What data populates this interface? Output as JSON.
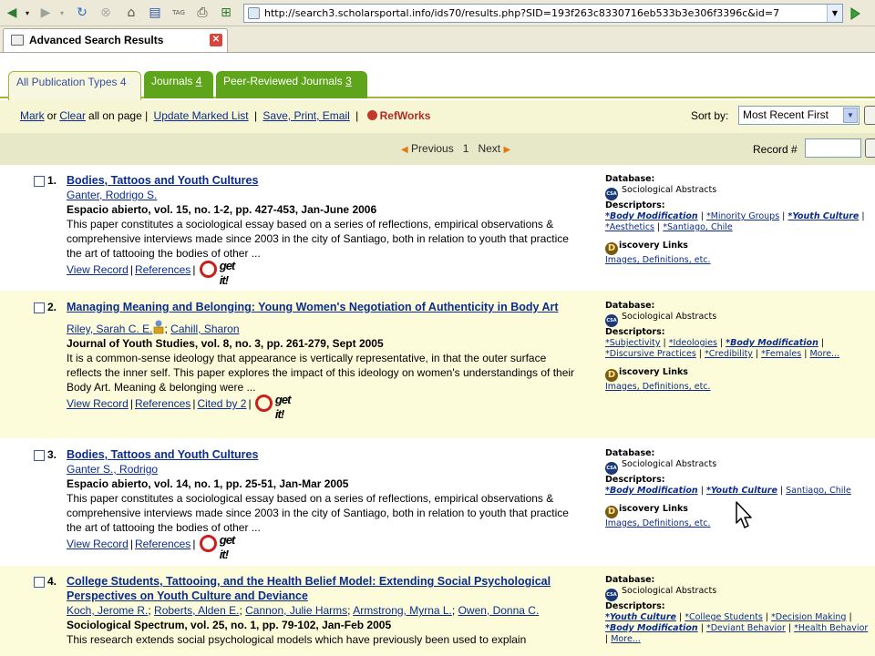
{
  "browser": {
    "url": "http://search3.scholarsportal.info/ids70/results.php?SID=193f263c8330716eb533b3e306f3396c&id=7",
    "tab_title": "Advanced Search Results"
  },
  "page_tabs": [
    {
      "label": "All Publication Types",
      "count": "4"
    },
    {
      "label": "Journals",
      "count": "4"
    },
    {
      "label": "Peer-Reviewed Journals",
      "count": "3"
    }
  ],
  "toolbar": {
    "mark": "Mark",
    "or": "or",
    "clear": "Clear",
    "all_on_page": "all on page |",
    "update": "Update Marked List",
    "sep": "|",
    "save": "Save, Print, Email",
    "sep2": "|",
    "refworks": "RefWorks",
    "sort_label": "Sort by:",
    "sort_value": "Most Recent First"
  },
  "pager": {
    "previous": "Previous",
    "page": "1",
    "next": "Next",
    "record_label": "Record #"
  },
  "labels": {
    "database": "Database:",
    "descriptors": "Descriptors:",
    "discovery": "iscovery Links",
    "discovery_sub": "Images, Definitions, etc.",
    "view_record": "View Record",
    "references": "References",
    "get_it": "get it!"
  },
  "records": [
    {
      "number": "1.",
      "title": "Bodies, Tattoos and Youth Cultures",
      "authors": "Ganter, Rodrigo S.",
      "source": "Espacio abierto, vol. 15, no. 1-2, pp. 427-453, Jan-June 2006",
      "abstract": "This paper constitutes a sociological essay based on a series of reflections, empirical observations & comprehensive interviews made since 2003 in the city of Santiago, both in relation to youth that practice the art of tattooing the bodies of other ...",
      "database": "Sociological Abstracts",
      "cited_by": ""
    },
    {
      "number": "2.",
      "title": "Managing Meaning and Belonging: Young Women's Negotiation of Authenticity in Body Art",
      "author1": "Riley, Sarah C. E.",
      "author2": "Cahill, Sharon",
      "source": "Journal of Youth Studies, vol. 8, no. 3, pp. 261-279, Sept 2005",
      "abstract": "It is a common-sense ideology that appearance is vertically representative, in that the outer surface reflects the inner self. This paper explores the impact of this ideology on women's understandings of their Body Art. Meaning & belonging were ...",
      "database": "Sociological Abstracts",
      "cited_by": "Cited by 2"
    },
    {
      "number": "3.",
      "title": "Bodies, Tattoos and Youth Cultures",
      "authors": "Ganter S., Rodrigo",
      "source": "Espacio abierto, vol. 14, no. 1, pp. 25-51, Jan-Mar 2005",
      "abstract": "This paper constitutes a sociological essay based on a series of reflections, empirical observations & comprehensive interviews made since 2003 in the city of Santiago, both in relation to youth that practice the art of tattooing the bodies of other ...",
      "database": "Sociological Abstracts",
      "cited_by": ""
    },
    {
      "number": "4.",
      "title": "College Students, Tattooing, and the Health Belief Model: Extending Social Psychological Perspectives on Youth Culture and Deviance",
      "authors": [
        "Koch, Jerome R.",
        "Roberts, Alden E.",
        "Cannon, Julie Harms",
        "Armstrong, Myrna L.",
        "Owen, Donna C."
      ],
      "source": "Sociological Spectrum, vol. 25, no. 1, pp. 79-102, Jan-Feb 2005",
      "abstract": "This research extends social psychological models which have previously been used to explain",
      "database": "Sociological Abstracts"
    }
  ],
  "descriptors": {
    "r1": [
      "*Body Modification",
      "*Minority Groups",
      "*Youth Culture",
      "*Aesthetics",
      "*Santiago, Chile"
    ],
    "r2": [
      "*Subjectivity",
      "*Ideologies",
      "*Body Modification",
      "*Discursive Practices",
      "*Credibility",
      "*Females",
      "More..."
    ],
    "r3": [
      "*Body Modification",
      "*Youth Culture",
      "Santiago, Chile"
    ],
    "r4": [
      "*Youth Culture",
      "*College Students",
      "*Decision Making",
      "*Body Modification",
      "*Deviant Behavior",
      "*Health Behavior",
      "More..."
    ]
  },
  "colors": {
    "tab_green": "#5fa51b",
    "toolbar_bg": "#f6f6d5",
    "alt_row": "#fcfcdb",
    "link": "#0b2c8c"
  }
}
